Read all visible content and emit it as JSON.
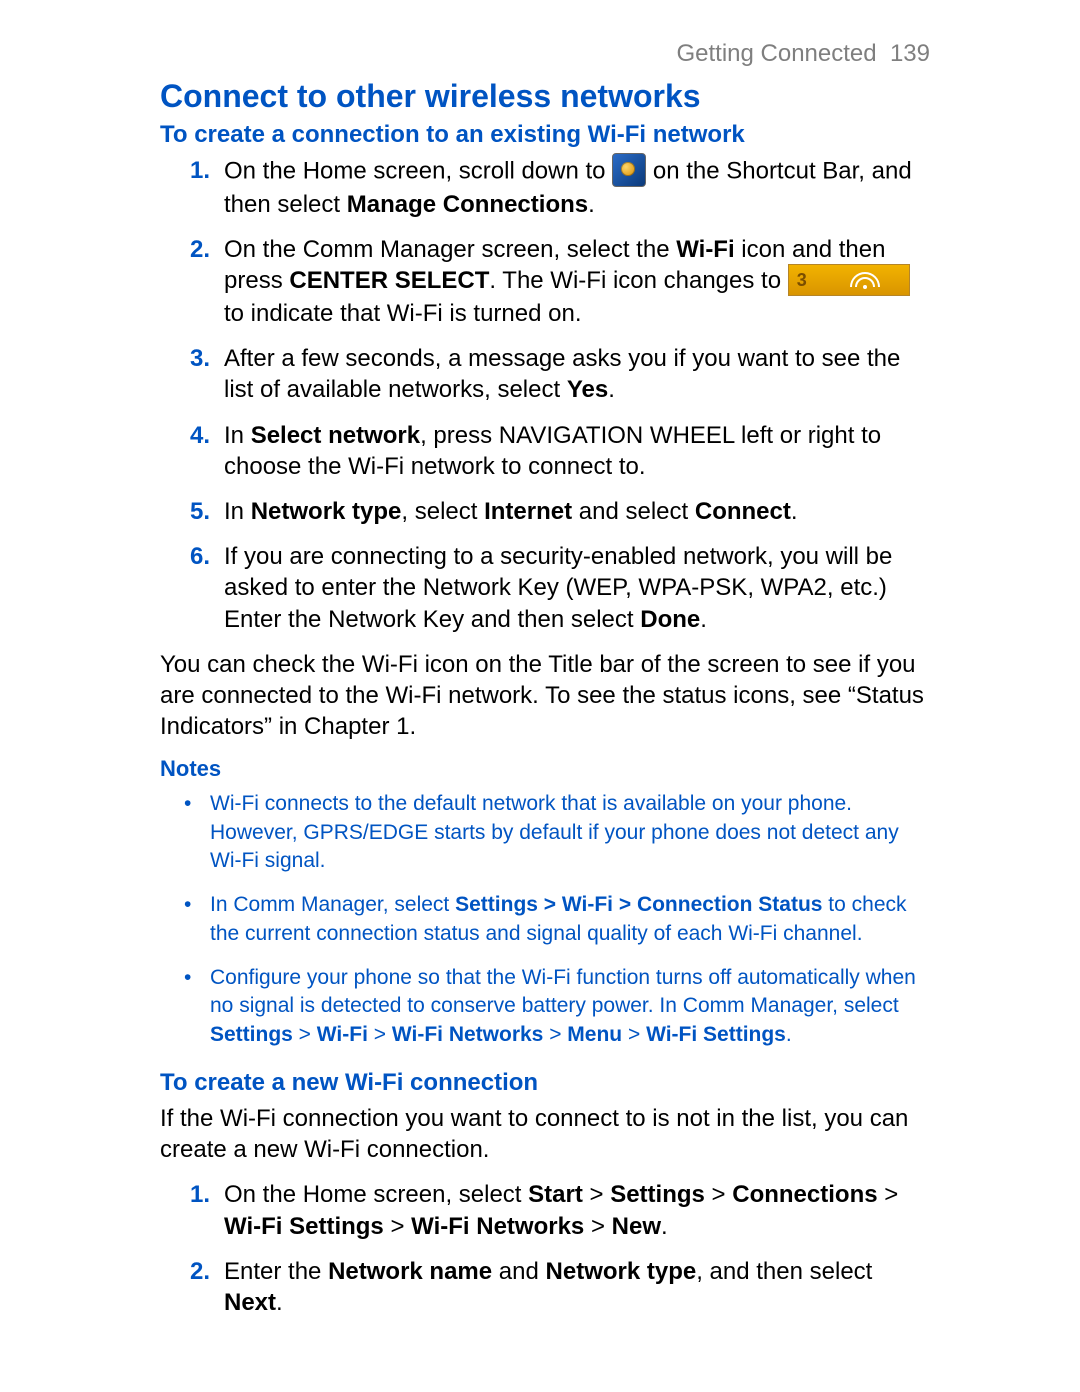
{
  "header": {
    "chapter": "Getting Connected",
    "page": "139"
  },
  "title": "Connect to other wireless networks",
  "section1": {
    "heading": "To create a connection to an existing Wi-Fi network",
    "step1_a": "On the Home screen, scroll down to ",
    "step1_b": " on the Shortcut Bar, and then select ",
    "step1_bold": "Manage Connections",
    "step1_c": ".",
    "step2_a": "On the Comm Manager screen, select the ",
    "step2_b1": "Wi-Fi",
    "step2_c": " icon and then press ",
    "step2_b2": "CENTER SELECT",
    "step2_d": ". The Wi-Fi icon changes to ",
    "step2_e": " to indicate that Wi-Fi is turned on.",
    "step3_a": "After a few seconds, a message asks you if you want to see the list of available networks, select ",
    "step3_b": "Yes",
    "step3_c": ".",
    "step4_a": "In ",
    "step4_b": "Select network",
    "step4_c": ", press NAVIGATION WHEEL left or right to choose the Wi-Fi network to connect to.",
    "step5_a": "In ",
    "step5_b1": "Network type",
    "step5_c": ", select ",
    "step5_b2": "Internet",
    "step5_d": " and select ",
    "step5_b3": "Connect",
    "step5_e": ".",
    "step6_a": "If you are connecting to a security-enabled network, you will be asked to enter the Network Key (WEP, WPA-PSK, WPA2, etc.) Enter the Network Key and then select ",
    "step6_b": "Done",
    "step6_c": "."
  },
  "para1": "You can check the Wi-Fi icon on the Title bar of the screen to see if you are connected to the Wi-Fi network. To see the status icons, see “Status Indicators” in Chapter 1.",
  "notes": {
    "heading": "Notes",
    "n1": "Wi-Fi connects to the default network that is available on your phone. However, GPRS/EDGE starts by default if your phone does not detect any Wi-Fi signal.",
    "n2_a": "In Comm Manager, select ",
    "n2_b": "Settings > Wi-Fi > Connection Status",
    "n2_c": " to check the current connection status and signal quality of each Wi-Fi channel.",
    "n3_a": "Configure your phone so that the Wi-Fi function turns off automatically when no signal is detected to conserve battery power. In Comm Manager, select ",
    "n3_p1": "Settings",
    "n3_gt": " > ",
    "n3_p2": "Wi-Fi",
    "n3_p3": "Wi-Fi Networks",
    "n3_p4": "Menu",
    "n3_p5": "Wi-Fi Settings",
    "n3_dot": "."
  },
  "section2": {
    "heading": "To create a new Wi-Fi connection",
    "intro": "If the Wi-Fi connection you want to connect to is not in the list, you can create a new Wi-Fi connection.",
    "s1_a": "On the Home screen, select ",
    "s1_p1": "Start",
    "gt": " > ",
    "s1_p2": "Settings",
    "s1_p3": "Connections",
    "s1_p4": "Wi-Fi Settings",
    "s1_p5": "Wi-Fi Networks",
    "s1_p6": "New",
    "s1_dot": ".",
    "s2_a": "Enter the ",
    "s2_b1": "Network name",
    "s2_mid": " and ",
    "s2_b2": "Network type",
    "s2_c": ", and then select ",
    "s2_b3": "Next",
    "s2_dot": "."
  },
  "nums": {
    "n1": "1.",
    "n2": "2.",
    "n3": "3.",
    "n4": "4.",
    "n5": "5.",
    "n6": "6."
  },
  "bullet": "•"
}
